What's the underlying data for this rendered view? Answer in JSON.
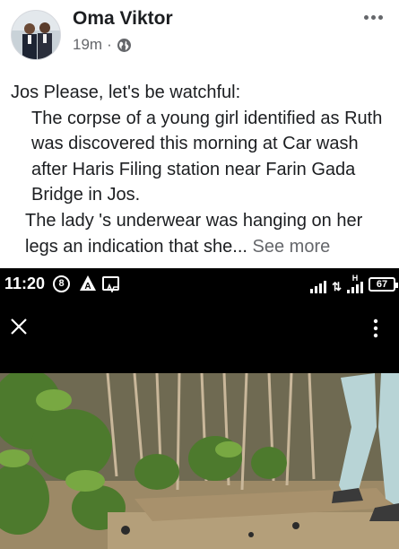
{
  "post": {
    "author": "Oma Viktor",
    "time": "19m",
    "separator": "·",
    "privacy_icon": "globe-icon",
    "more_icon": "more-horizontal-icon",
    "lines": [
      "Jos  Please, let's be watchful:",
      "The corpse of a young girl identified as Ruth was discovered this morning at Car wash after Haris Filing station near  Farin Gada Bridge in Jos.",
      "The lady 's underwear was hanging on her legs an indication that she..."
    ],
    "see_more": "See more"
  },
  "screenshot": {
    "status_bar": {
      "time": "11:20",
      "icon_b": "8",
      "icon_a": "A",
      "network": "H",
      "battery": "67"
    },
    "viewer": {
      "close_icon": "close-icon",
      "menu_icon": "overflow-menu-icon"
    }
  }
}
